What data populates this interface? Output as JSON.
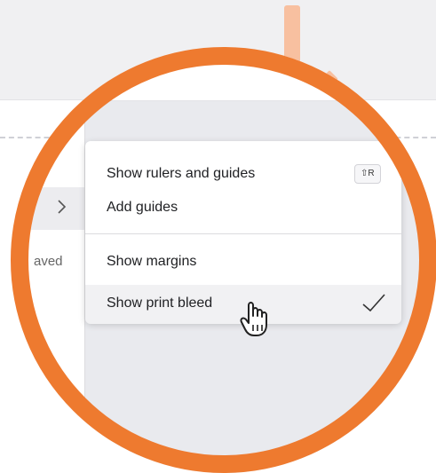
{
  "side_panel": {
    "partial_text": "aved"
  },
  "menu": {
    "items": [
      {
        "label": "Show rulers and guides",
        "shortcut": "⇧R"
      },
      {
        "label": "Add guides"
      },
      {
        "label": "Show margins"
      },
      {
        "label": "Show print bleed",
        "checked": true
      }
    ]
  },
  "colors": {
    "ring": "#ee7a2f",
    "accent_light": "#f8c0a0",
    "hover_row": "#f1f1f3"
  },
  "icons": {
    "chevron": "chevron-right-icon",
    "check": "check-icon",
    "cursor": "hand-pointer-cursor-icon"
  }
}
